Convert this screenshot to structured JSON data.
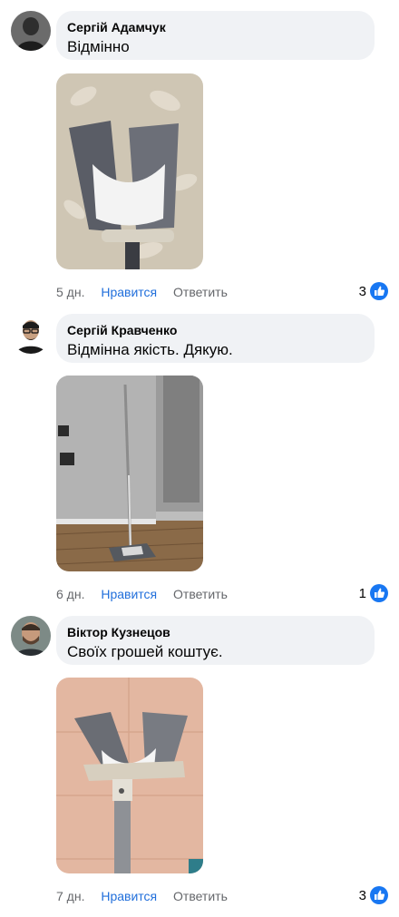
{
  "comments": [
    {
      "author": "Сергій Адамчук",
      "text": "Відмінно",
      "time": "5 дн.",
      "like_label": "Нравится",
      "reply_label": "Ответить",
      "reactions": "3",
      "reaction_icon": "thumbs-up-icon"
    },
    {
      "author": "Сергій Кравченко",
      "text": "Відмінна якість. Дякую.",
      "time": "6 дн.",
      "like_label": "Нравится",
      "reply_label": "Ответить",
      "reactions": "1",
      "reaction_icon": "thumbs-up-icon"
    },
    {
      "author": "Віктор Кузнецов",
      "text": "Своїх грошей коштує.",
      "time": "7 дн.",
      "like_label": "Нравится",
      "reply_label": "Ответить",
      "reactions": "3",
      "reaction_icon": "thumbs-up-icon"
    }
  ],
  "colors": {
    "bubble": "#f0f2f5",
    "link": "#216fdb",
    "meta": "#65676b",
    "like_badge": "#1877f2"
  }
}
